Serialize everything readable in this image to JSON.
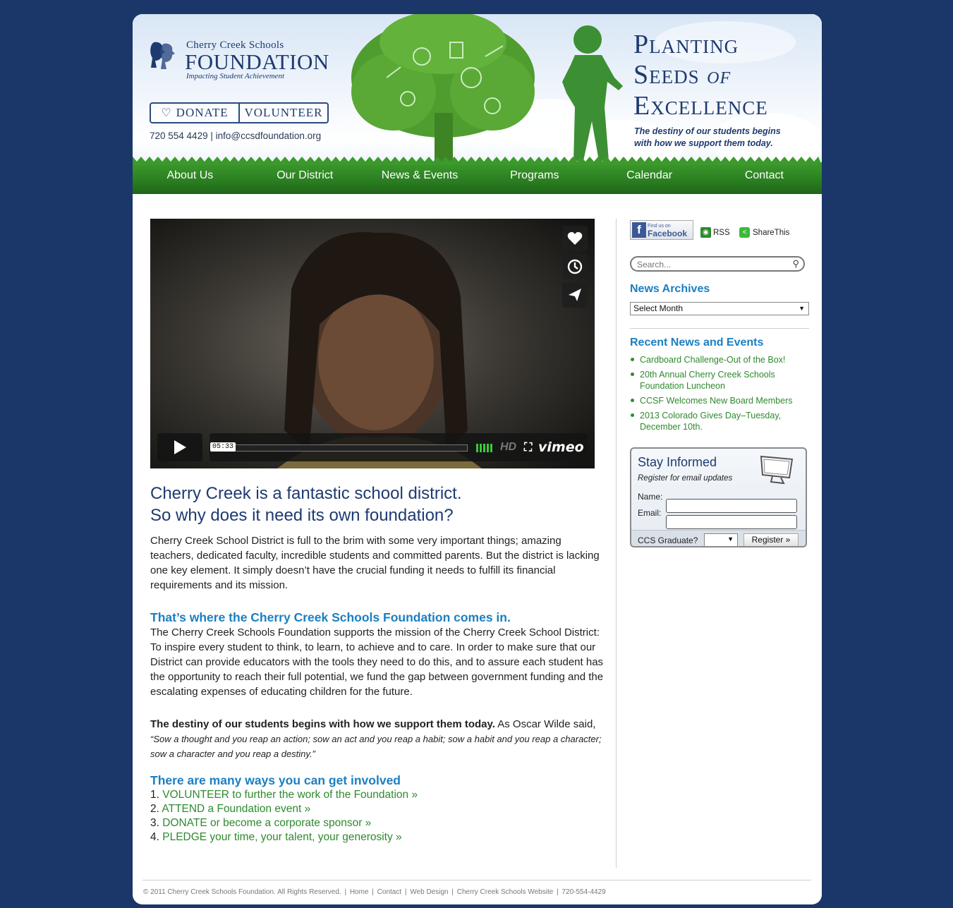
{
  "logo": {
    "line1": "Cherry Creek Schools",
    "line2": "FOUNDATION",
    "line3": "Impacting Student Achievement"
  },
  "header_buttons": {
    "donate": "DONATE",
    "volunteer": "VOLUNTEER"
  },
  "contact": {
    "phone": "720 554 4429",
    "separator": "|",
    "email": "info@ccsdfoundation.org"
  },
  "slogan": {
    "line1": "Planting",
    "line2a": "Seeds",
    "line2b": "of",
    "line3": "Excellence",
    "tagline": "The destiny of our students begins with how we support them today."
  },
  "nav": [
    "About Us",
    "Our District",
    "News & Events",
    "Programs",
    "Calendar",
    "Contact"
  ],
  "video": {
    "timecode": "05:33",
    "hd_label": "HD",
    "brand": "vimeo",
    "progress": 0,
    "side_icons": [
      "heart-icon",
      "clock-icon",
      "send-icon"
    ]
  },
  "main": {
    "heading_line1": "Cherry Creek is a fantastic school district.",
    "heading_line2": "So why does it need its own foundation?",
    "para1": "Cherry Creek School District is full to the brim with some very important things; amazing teachers, dedicated faculty, incredible students and committed parents. But the district is lacking one key element. It simply doesn’t have the crucial funding it needs to fulfill its financial requirements and its mission.",
    "section2_heading": "That’s where the Cherry Creek Schools Foundation comes in.",
    "section2_text": "The Cherry Creek Schools Foundation supports the mission of the Cherry Creek School District: To inspire every student to think, to learn, to achieve and to care.  In order to make sure that our District can provide educators with the tools they need to do this, and to assure each student has the opportunity to reach their full potential, we fund the gap between government funding and the escalating expenses of educating children for the future.",
    "section3_bold": "The destiny of our students begins with how we support them today.",
    "section3_plain": " As Oscar Wilde said, ",
    "section3_quote": "“Sow a thought and you reap an action; sow an act and you reap a habit; sow a habit and you reap a character; sow a character and you reap a destiny.”",
    "section4_heading": "There are many ways you can get involved",
    "involve": [
      {
        "num": "1. ",
        "text": "VOLUNTEER to further the work of the Foundation »"
      },
      {
        "num": "2. ",
        "text": "ATTEND a Foundation event »"
      },
      {
        "num": "3. ",
        "text": "DONATE or become a corporate sponsor »"
      },
      {
        "num": "4. ",
        "text": "PLEDGE your time, your talent, your generosity »"
      }
    ]
  },
  "sidebar": {
    "facebook_line1": "Find us on",
    "facebook_line2": "Facebook",
    "rss": "RSS",
    "sharethis": "ShareThis",
    "search_placeholder": "Search...",
    "archives_heading": "News Archives",
    "archives_select": "Select Month",
    "recent_heading": "Recent News and Events",
    "recent": [
      "Cardboard Challenge-Out of the Box!",
      "20th Annual Cherry Creek Schools Foundation Luncheon",
      "CCSF Welcomes New Board Members",
      "2013 Colorado Gives Day–Tuesday, December 10th."
    ],
    "stay": {
      "title": "Stay Informed",
      "subtitle": "Register for email updates",
      "name_label": "Name:",
      "email_label": "Email:",
      "graduate_label": "CCS Graduate?",
      "register_button": "Register »"
    }
  },
  "footer": {
    "copyright": "© 2011 Cherry Creek Schools Foundation. All Rights Reserved.",
    "links": [
      "Home",
      "Contact",
      "Web Design",
      "Cherry Creek Schools Website",
      "720-554-4429"
    ]
  },
  "colors": {
    "background": "#1b3668",
    "navy": "#1e3a70",
    "green": "#2e8a2e",
    "blue_heading": "#1b7fc1"
  }
}
